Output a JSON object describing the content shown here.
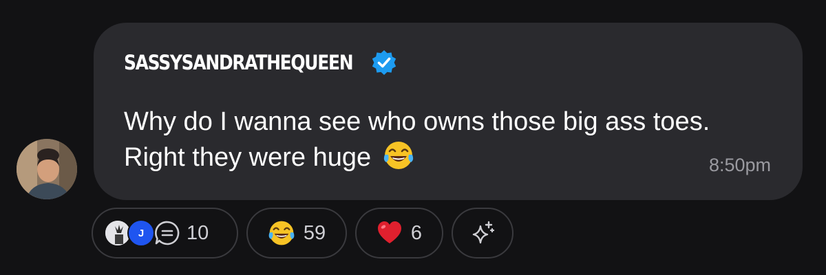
{
  "post": {
    "username": "SASSYSANDRATHEQUEEN",
    "verified_icon": "verified-badge-icon",
    "message_text": "Why do I wanna see who owns those big ass toes. Right they were huge",
    "message_emoji": "😂",
    "timestamp": "8:50pm",
    "avatar_icon": "user-avatar"
  },
  "reactions": {
    "replies": {
      "avatar_initial": "J",
      "count": "10",
      "icon": "comment-icon"
    },
    "laugh": {
      "emoji": "😂",
      "count": "59"
    },
    "heart": {
      "emoji": "❤️",
      "count": "6"
    },
    "add_reaction": {
      "icon": "sparkle-add-icon"
    }
  },
  "colors": {
    "background": "#121214",
    "bubble": "#2a2a2e",
    "verified_blue": "#1d9bf0",
    "timestamp": "#9a9aa0",
    "avatar_j": "#1f55f0",
    "heart": "#e0202e"
  }
}
